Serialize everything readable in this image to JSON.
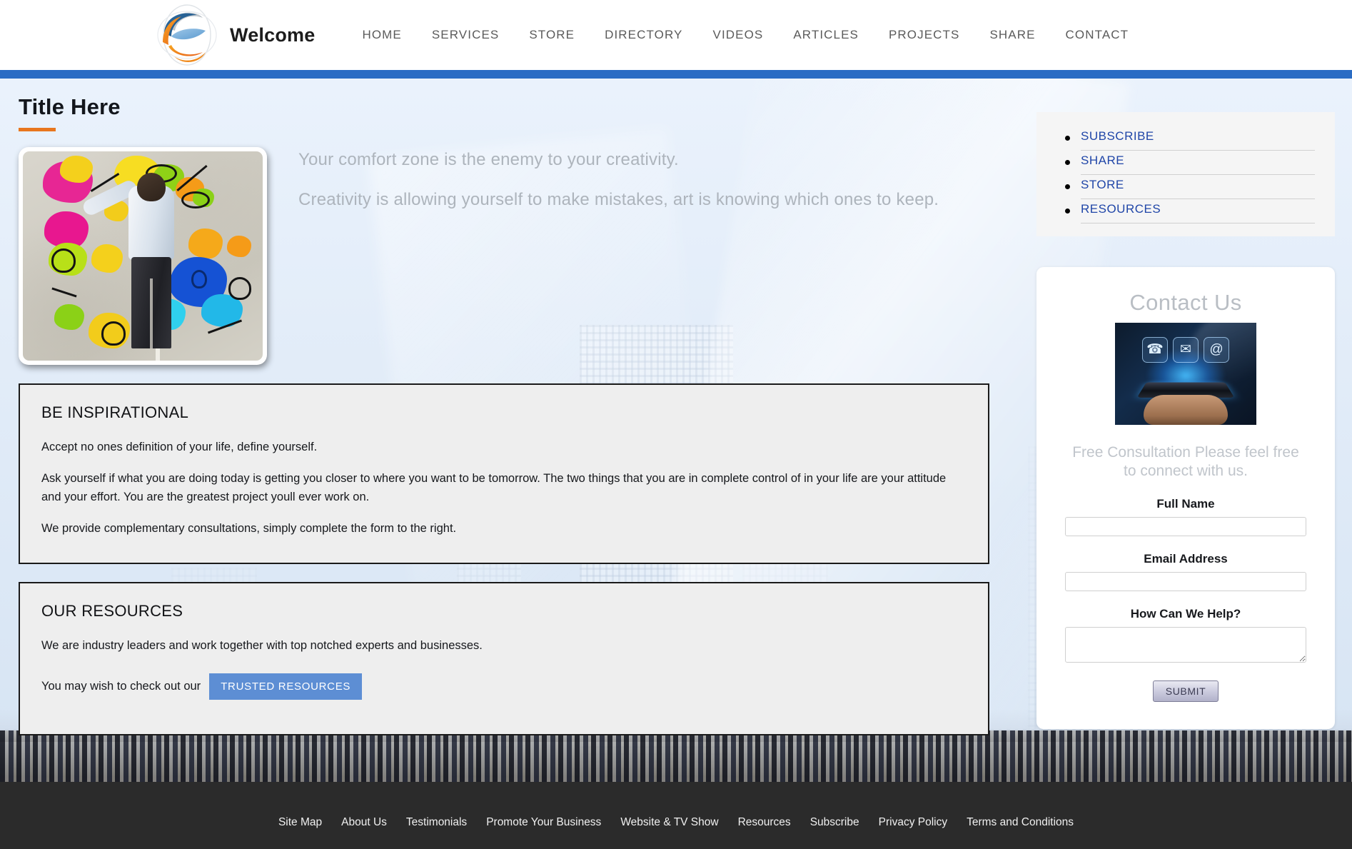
{
  "header": {
    "brand_name": "Welcome",
    "logo_icon": "globe-swirl-logo",
    "nav": [
      {
        "label": "HOME"
      },
      {
        "label": "SERVICES"
      },
      {
        "label": "STORE"
      },
      {
        "label": "DIRECTORY"
      },
      {
        "label": "VIDEOS"
      },
      {
        "label": "ARTICLES"
      },
      {
        "label": "PROJECTS"
      },
      {
        "label": "SHARE"
      },
      {
        "label": "CONTACT"
      }
    ]
  },
  "main": {
    "page_title": "Title Here",
    "hero_image_alt": "man-drawing-creativity-wall-art",
    "quotes": [
      "Your comfort zone is the enemy to your creativity.",
      "Creativity is allowing yourself to make mistakes, art is knowing which ones to keep."
    ],
    "inspire_panel": {
      "heading": "BE INSPIRATIONAL",
      "paragraph_1": "Accept no ones definition of your life, define yourself.",
      "paragraph_2": "Ask yourself if what you are doing today is getting you closer to where you want to be tomorrow.  The two things that you are in complete control of in your life are your attitude and your effort. You are the greatest project youll ever work on.",
      "paragraph_3": "We provide complementary consultations, simply complete the form to the right."
    },
    "resources_panel": {
      "heading": "OUR RESOURCES",
      "paragraph_1": "We are industry leaders and work together with top notched experts and businesses.",
      "cta_prefix": "You may wish to check out our",
      "cta_button": "TRUSTED RESOURCES"
    }
  },
  "sidebar": {
    "items": [
      {
        "label": "SUBSCRIBE"
      },
      {
        "label": "SHARE"
      },
      {
        "label": "STORE"
      },
      {
        "label": "RESOURCES"
      }
    ]
  },
  "contact": {
    "title": "Contact Us",
    "image_alt": "hand-holding-phone-contact-icons",
    "icons": [
      "phone-icon",
      "envelope-icon",
      "at-sign-icon"
    ],
    "subtitle": "Free Consultation\nPlease feel free to connect with us.",
    "fields": [
      {
        "label": "Full Name",
        "value": "",
        "placeholder": ""
      },
      {
        "label": "Email Address",
        "value": "",
        "placeholder": ""
      },
      {
        "label": "How Can We Help?",
        "value": "",
        "placeholder": ""
      }
    ],
    "submit_label": "SUBMIT"
  },
  "footer": {
    "links": [
      {
        "label": "Site Map"
      },
      {
        "label": "About Us"
      },
      {
        "label": "Testimonials"
      },
      {
        "label": "Promote Your Business"
      },
      {
        "label": "Website & TV Show"
      },
      {
        "label": "Resources"
      },
      {
        "label": "Subscribe"
      },
      {
        "label": "Privacy Policy"
      },
      {
        "label": "Terms and Conditions"
      }
    ]
  },
  "colors": {
    "accent_orange": "#e8761e",
    "header_bar_blue": "#2a6cc4",
    "link_blue": "#2046a8",
    "button_blue": "#5d8ed4",
    "footer_dark": "#2b2b2b"
  }
}
